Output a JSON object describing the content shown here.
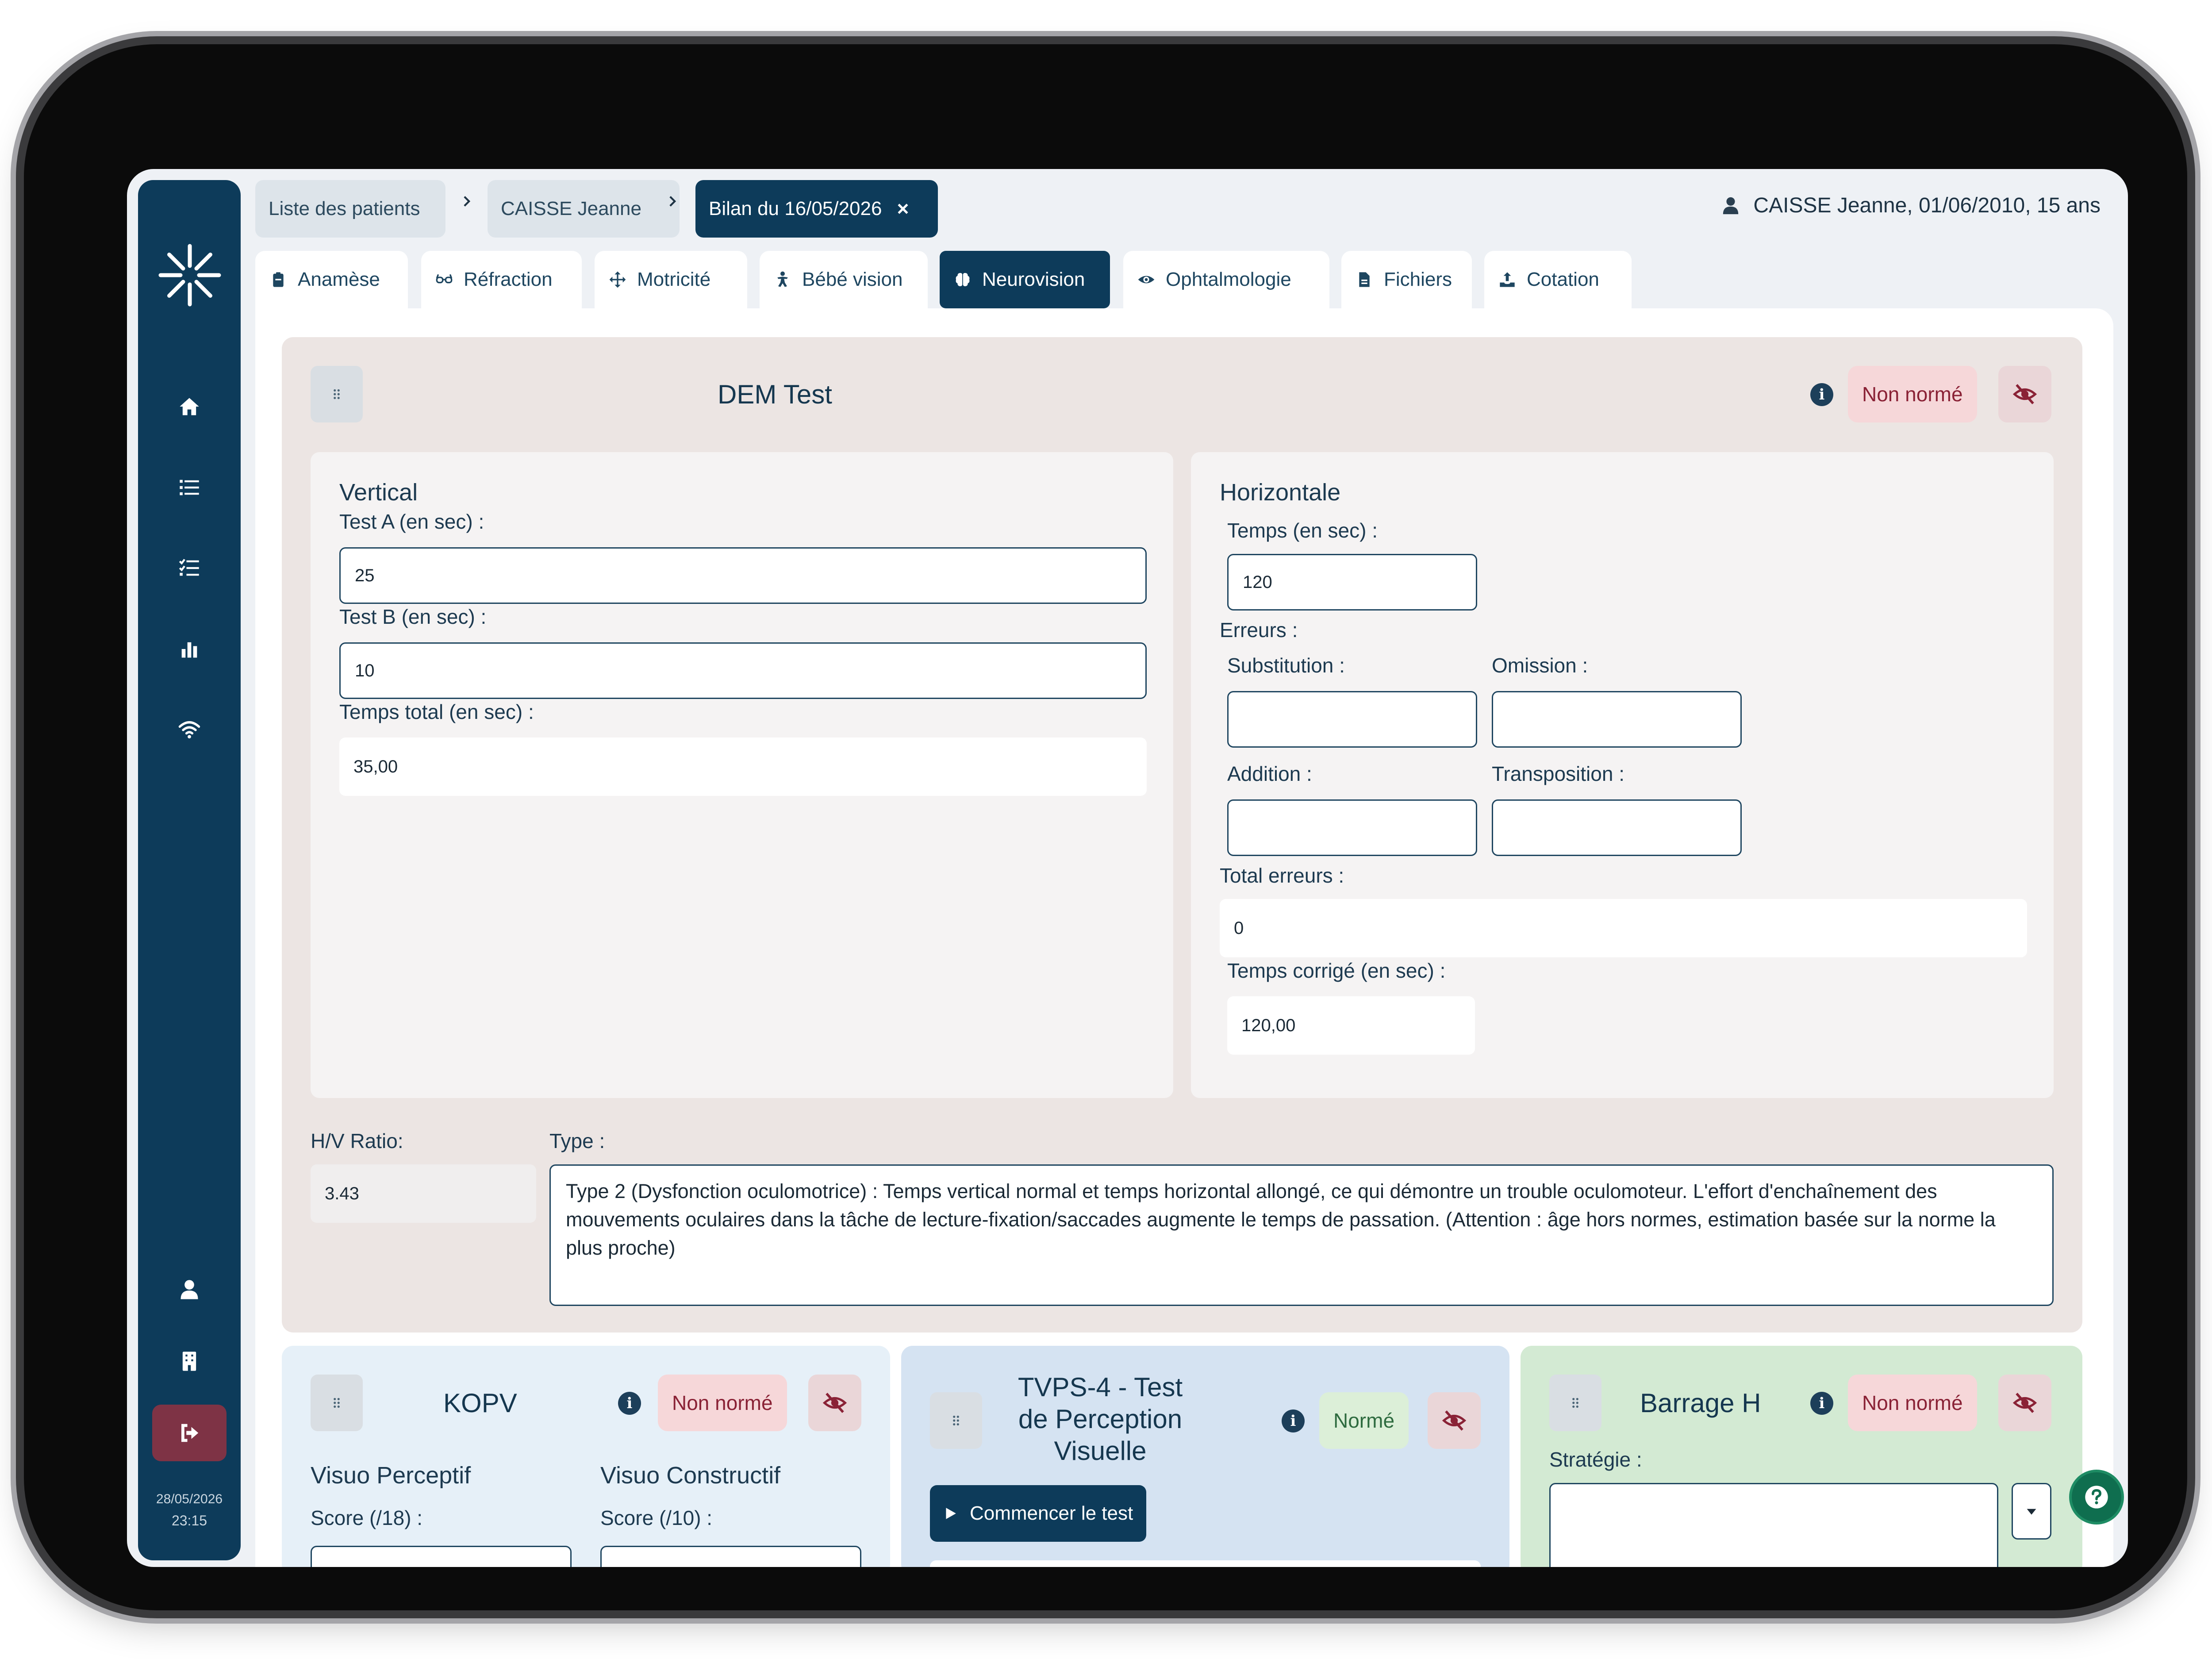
{
  "sidebar": {
    "date": "28/05/2026",
    "time": "23:15",
    "icons": [
      "logo-icon",
      "home-icon",
      "list-icon",
      "checklist-icon",
      "chart-icon",
      "wifi-icon",
      "user-icon",
      "building-icon",
      "logout-icon"
    ]
  },
  "breadcrumb": {
    "items": [
      "Liste des patients",
      "CAISSE Jeanne",
      "Bilan du 16/05/2026"
    ]
  },
  "patient_label": "CAISSE Jeanne, 01/06/2010, 15 ans",
  "tabs": [
    {
      "label": "Anamèse",
      "icon": "clipboard-icon"
    },
    {
      "label": "Réfraction",
      "icon": "glasses-icon"
    },
    {
      "label": "Motricité",
      "icon": "move-icon"
    },
    {
      "label": "Bébé vision",
      "icon": "baby-icon"
    },
    {
      "label": "Neurovision",
      "icon": "brain-icon"
    },
    {
      "label": "Ophtalmologie",
      "icon": "eye-icon"
    },
    {
      "label": "Fichiers",
      "icon": "file-icon"
    },
    {
      "label": "Cotation",
      "icon": "upload-icon"
    }
  ],
  "active_tab": "Neurovision",
  "dem": {
    "title": "DEM Test",
    "badge": "Non normé",
    "vertical": {
      "heading": "Vertical",
      "test_a_label": "Test A (en sec) :",
      "test_a_value": "25",
      "test_b_label": "Test B (en sec) :",
      "test_b_value": "10",
      "total_label": "Temps total (en sec) :",
      "total_value": "35,00"
    },
    "horizontal": {
      "heading": "Horizontale",
      "time_label": "Temps (en sec) :",
      "time_value": "120",
      "errors_label": "Erreurs :",
      "substitution_label": "Substitution :",
      "omission_label": "Omission :",
      "addition_label": "Addition :",
      "transposition_label": "Transposition :",
      "total_errors_label": "Total erreurs :",
      "total_errors_value": "0",
      "corrected_label": "Temps corrigé (en sec) :",
      "corrected_value": "120,00"
    },
    "ratio_label": "H/V Ratio:",
    "ratio_value": "3.43",
    "type_label": "Type :",
    "type_value": "Type 2 (Dysfonction oculomotrice) : Temps vertical normal et temps horizontal allongé, ce qui démontre un trouble oculomoteur. L'effort d'enchaînement des mouvements oculaires dans la tâche de lecture-fixation/saccades augmente le temps de passation. (Attention : âge hors normes, estimation basée sur la norme la plus proche)"
  },
  "kopv": {
    "title": "KOPV",
    "badge": "Non normé",
    "left_heading": "Visuo Perceptif",
    "left_score_label": "Score (/18) :",
    "right_heading": "Visuo Constructif",
    "right_score_label": "Score (/10) :"
  },
  "tvps": {
    "title": "TVPS-4 - Test de Perception Visuelle",
    "badge": "Normé",
    "start_label": "Commencer le test"
  },
  "barrage": {
    "title": "Barrage H",
    "badge": "Non normé",
    "strategy_label": "Stratégie :"
  },
  "colors": {
    "navy": "#0d3b5a",
    "logout": "#7e3345",
    "badge_red": "#f6d7d9",
    "badge_green": "#dcefd8",
    "help": "#0f6e4f"
  }
}
